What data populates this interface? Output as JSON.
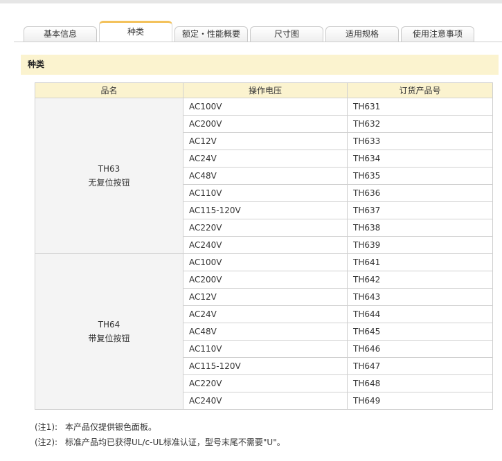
{
  "tabs": [
    {
      "label": "基本信息",
      "active": false
    },
    {
      "label": "种类",
      "active": true
    },
    {
      "label": "额定・性能概要",
      "active": false
    },
    {
      "label": "尺寸图",
      "active": false
    },
    {
      "label": "适用规格",
      "active": false
    },
    {
      "label": "使用注意事项",
      "active": false
    }
  ],
  "section": {
    "title": "种类"
  },
  "table": {
    "headers": [
      "品名",
      "操作电压",
      "订货产品号"
    ],
    "groups": [
      {
        "name_line1": "TH63",
        "name_line2": "无复位按钮",
        "rows": [
          {
            "voltage": "AC100V",
            "code": "TH631"
          },
          {
            "voltage": "AC200V",
            "code": "TH632"
          },
          {
            "voltage": "AC12V",
            "code": "TH633"
          },
          {
            "voltage": "AC24V",
            "code": "TH634"
          },
          {
            "voltage": "AC48V",
            "code": "TH635"
          },
          {
            "voltage": "AC110V",
            "code": "TH636"
          },
          {
            "voltage": "AC115-120V",
            "code": "TH637"
          },
          {
            "voltage": "AC220V",
            "code": "TH638"
          },
          {
            "voltage": "AC240V",
            "code": "TH639"
          }
        ]
      },
      {
        "name_line1": "TH64",
        "name_line2": "带复位按钮",
        "rows": [
          {
            "voltage": "AC100V",
            "code": "TH641"
          },
          {
            "voltage": "AC200V",
            "code": "TH642"
          },
          {
            "voltage": "AC12V",
            "code": "TH643"
          },
          {
            "voltage": "AC24V",
            "code": "TH644"
          },
          {
            "voltage": "AC48V",
            "code": "TH645"
          },
          {
            "voltage": "AC110V",
            "code": "TH646"
          },
          {
            "voltage": "AC115-120V",
            "code": "TH647"
          },
          {
            "voltage": "AC220V",
            "code": "TH648"
          },
          {
            "voltage": "AC240V",
            "code": "TH649"
          }
        ]
      }
    ]
  },
  "notes": [
    {
      "mark": "(注1):",
      "text": "本产品仅提供银色面板。"
    },
    {
      "mark": "(注2):",
      "text": "标准产品均已获得UL/c-UL标准认证，型号末尾不需要\"U\"。"
    }
  ],
  "colors": {
    "tab_accent": "#f3c25c",
    "header_bg": "#fbf3cf",
    "name_cell_bg": "#f4f4f4"
  }
}
